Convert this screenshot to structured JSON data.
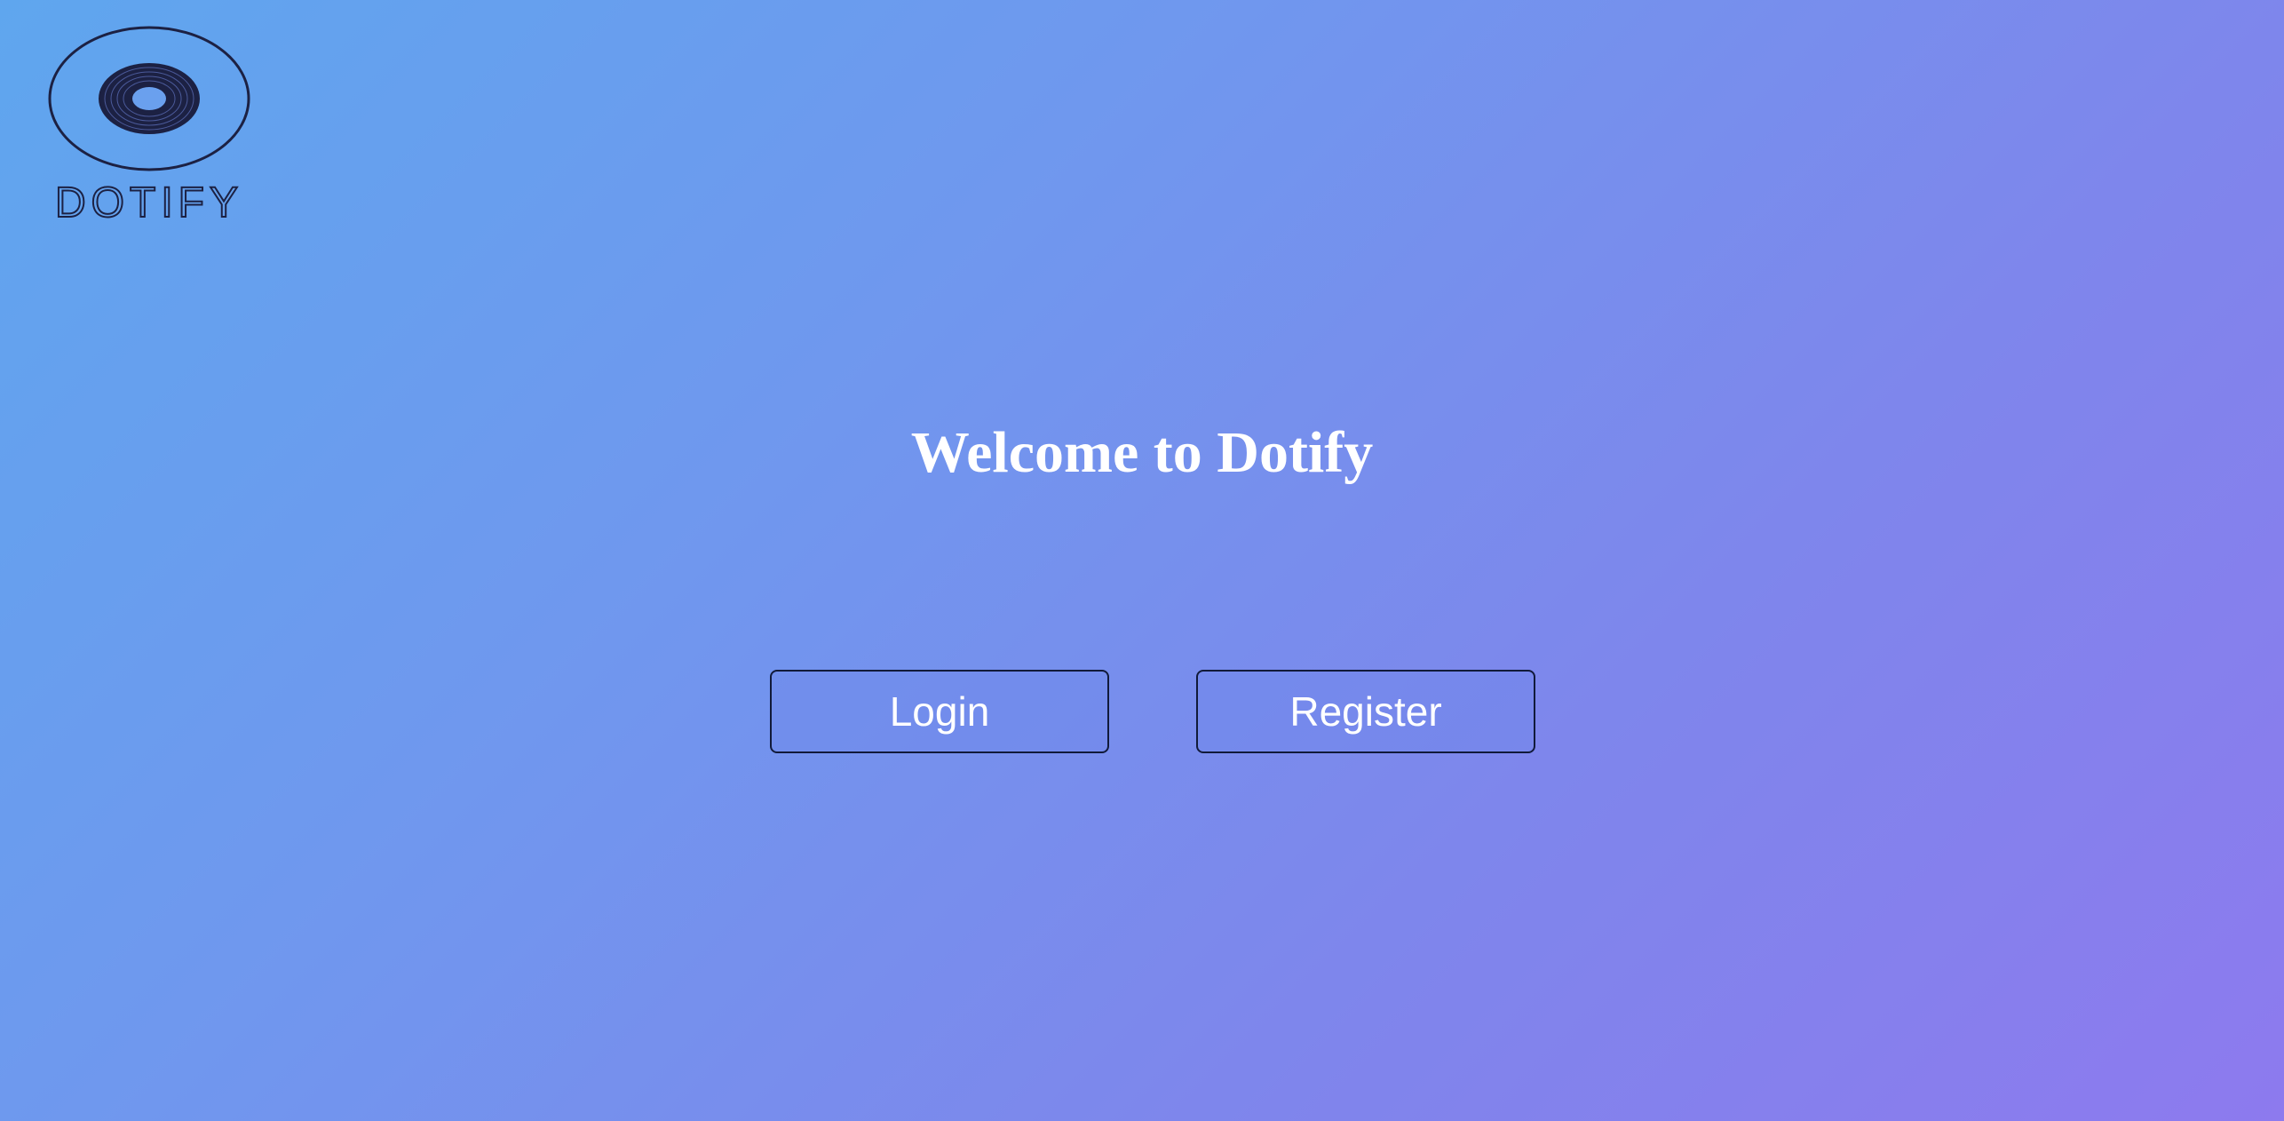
{
  "logo": {
    "text": "DOTIFY",
    "color": "#1c2143"
  },
  "hero": {
    "title": "Welcome to Dotify"
  },
  "actions": {
    "login_label": "Login",
    "register_label": "Register"
  },
  "colors": {
    "gradient_start": "#5fa6ee",
    "gradient_end": "#8d7aee",
    "text": "#ffffff",
    "button_border": "#111a3a"
  }
}
